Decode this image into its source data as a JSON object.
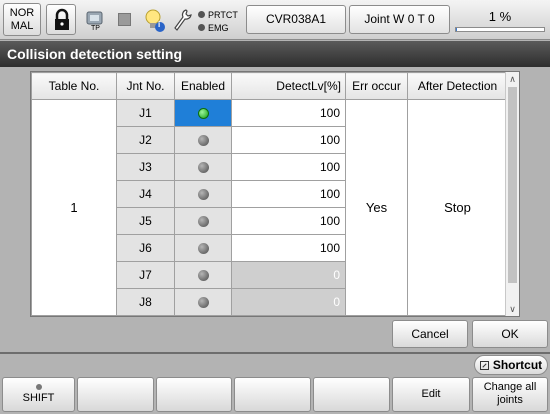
{
  "topbar": {
    "mode_line1": "NOR",
    "mode_line2": "MAL",
    "tp_label": "TP",
    "bulb_badge": "i",
    "prtct_label": "PRTCT",
    "emg_label": "EMG",
    "robot_name": "CVR038A1",
    "joint_status": "Joint W 0 T 0",
    "override": "1 %",
    "override_value": 1
  },
  "title": "Collision detection setting",
  "table": {
    "headers": [
      "Table No.",
      "Jnt No.",
      "Enabled",
      "DetectLv[%]",
      "Err occur",
      "After Detection"
    ],
    "table_no": "1",
    "err_occur": "Yes",
    "after_detection": "Stop",
    "rows": [
      {
        "jnt": "J1",
        "enabled": true,
        "level": "100",
        "active": true
      },
      {
        "jnt": "J2",
        "enabled": false,
        "level": "100",
        "active": true
      },
      {
        "jnt": "J3",
        "enabled": false,
        "level": "100",
        "active": true
      },
      {
        "jnt": "J4",
        "enabled": false,
        "level": "100",
        "active": true
      },
      {
        "jnt": "J5",
        "enabled": false,
        "level": "100",
        "active": true
      },
      {
        "jnt": "J6",
        "enabled": false,
        "level": "100",
        "active": true
      },
      {
        "jnt": "J7",
        "enabled": false,
        "level": "0",
        "active": false
      },
      {
        "jnt": "J8",
        "enabled": false,
        "level": "0",
        "active": false
      }
    ]
  },
  "buttons": {
    "cancel": "Cancel",
    "ok": "OK",
    "shortcut": "Shortcut"
  },
  "function_keys": {
    "shift": "SHIFT",
    "f2": "",
    "f3": "",
    "f4": "",
    "f5": "",
    "edit": "Edit",
    "change_all_line1": "Change all",
    "change_all_line2": "joints"
  },
  "colors": {
    "accent_blue": "#1f7fd8",
    "enabled_green": "#11a012",
    "title_bg": "#3a3a3a"
  }
}
